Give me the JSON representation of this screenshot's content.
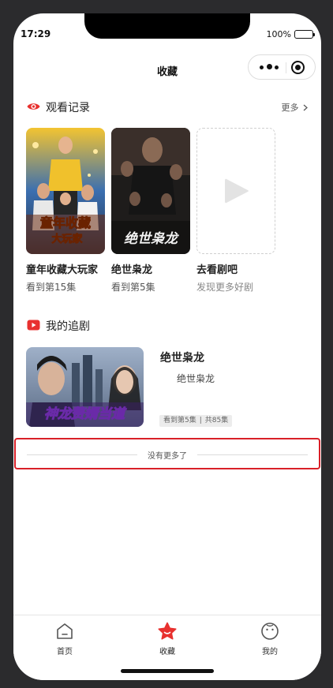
{
  "status_bar": {
    "time": "17:29",
    "battery": "100%"
  },
  "nav": {
    "title": "收藏"
  },
  "history": {
    "title": "观看记录",
    "more": "更多",
    "items": [
      {
        "title": "童年收藏大玩家",
        "progress": "看到第15集",
        "poster_text_1": "童年收藏",
        "poster_text_2": "大玩家"
      },
      {
        "title": "绝世枭龙",
        "progress": "看到第5集",
        "poster_text": "绝世枭龙"
      },
      {
        "title": "去看剧吧",
        "progress": "发现更多好剧"
      }
    ]
  },
  "follow": {
    "title": "我的追剧",
    "items": [
      {
        "title": "绝世枭龙",
        "subtitle": "绝世枭龙",
        "watched": "看到第5集",
        "total": "共85集",
        "separator": "|",
        "poster_text": "神龙赘婿当道"
      }
    ]
  },
  "list_end": {
    "text": "没有更多了"
  },
  "tabbar": {
    "items": [
      {
        "label": "首页",
        "icon": "home-icon"
      },
      {
        "label": "收藏",
        "icon": "star-icon"
      },
      {
        "label": "我的",
        "icon": "face-icon"
      }
    ]
  },
  "colors": {
    "accent": "#e8312f",
    "highlight_border": "#d92028",
    "text": "#222222",
    "muted": "#888888"
  }
}
